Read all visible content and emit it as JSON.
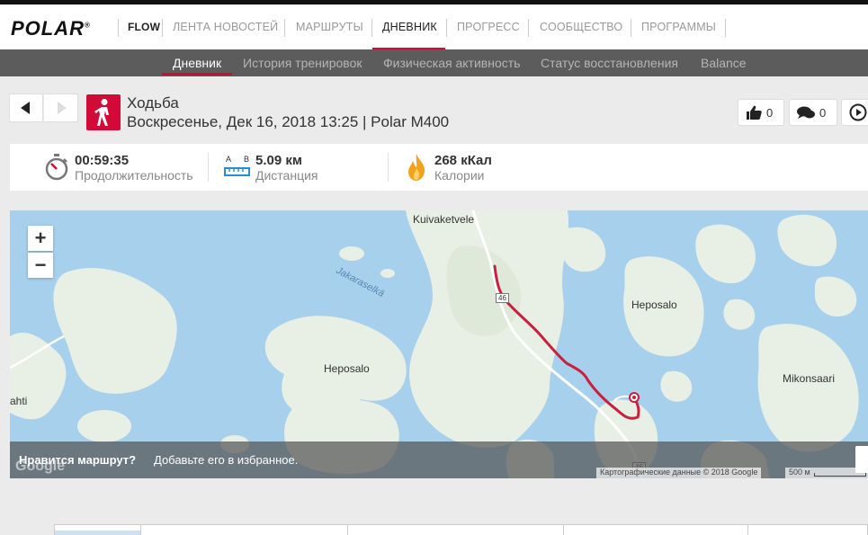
{
  "brand": {
    "logo": "POLAR",
    "app": "FLOW",
    "accent": "#d10a38"
  },
  "topnav": {
    "items": [
      {
        "label": "ЛЕНТА НОВОСТЕЙ"
      },
      {
        "label": "МАРШРУТЫ"
      },
      {
        "label": "ДНЕВНИК",
        "active": true
      },
      {
        "label": "ПРОГРЕСС"
      },
      {
        "label": "СООБЩЕСТВО"
      },
      {
        "label": "ПРОГРАММЫ"
      }
    ]
  },
  "subnav": {
    "items": [
      {
        "label": "Дневник",
        "active": true
      },
      {
        "label": "История тренировок"
      },
      {
        "label": "Физическая активность"
      },
      {
        "label": "Статус восстановления"
      },
      {
        "label": "Balance"
      }
    ]
  },
  "session": {
    "sport": "Ходьба",
    "subtitle": "Воскресенье, Дек 16, 2018 13:25 | Polar M400",
    "sport_icon": "walking-person-icon",
    "likes": "0",
    "comments": "0"
  },
  "stats": {
    "duration": {
      "value": "00:59:35",
      "label": "Продолжительность",
      "icon": "stopwatch-icon"
    },
    "distance": {
      "value": "5.09 км",
      "label": "Дистанция",
      "icon": "ruler-icon",
      "icon_text_a": "A",
      "icon_text_b": "B"
    },
    "calories": {
      "value": "268 кКал",
      "label": "Калории",
      "icon": "flame-icon"
    }
  },
  "map": {
    "zoom_in": "+",
    "zoom_out": "−",
    "labels": {
      "kuivaketvele": "Kuivaketvele",
      "jakaraselka": "Jakaraselkä",
      "heposalo_left": "Heposalo",
      "heposalo_right": "Heposalo",
      "mikonsaari": "Mikonsaari",
      "ahti": "ahti",
      "road_shield_top": "46",
      "road_shield_bottom": "46"
    },
    "favorite_bold": "Нравится маршрут?",
    "favorite_text": "Добавьте его в избранное.",
    "google": "Google",
    "attribution": "Картографические данные © 2018 Google",
    "scale": "500 м",
    "colors": {
      "water": "#a7d0ec",
      "land": "#e8efe4",
      "route": "#c8203f"
    }
  }
}
